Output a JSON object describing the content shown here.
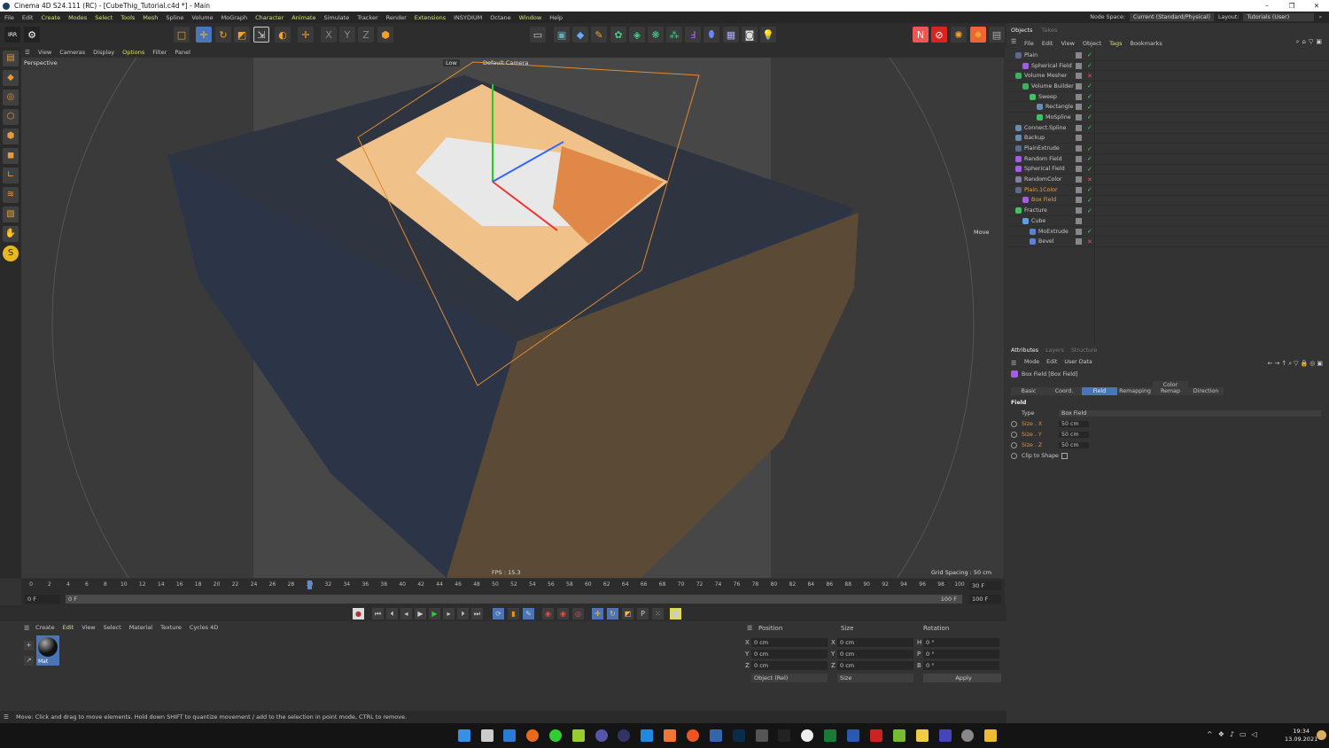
{
  "window": {
    "title": "Cinema 4D S24.111 (RC) - [CubeThig_Tutorial.c4d *] - Main",
    "controls": [
      "–",
      "❐",
      "✕"
    ]
  },
  "menu": [
    {
      "label": "File"
    },
    {
      "label": "Edit"
    },
    {
      "label": "Create",
      "hl": true
    },
    {
      "label": "Modes",
      "hl": true
    },
    {
      "label": "Select",
      "hl": true
    },
    {
      "label": "Tools",
      "hl": true
    },
    {
      "label": "Mesh",
      "hl": true
    },
    {
      "label": "Spline"
    },
    {
      "label": "Volume"
    },
    {
      "label": "MoGraph"
    },
    {
      "label": "Character",
      "hl": true
    },
    {
      "label": "Animate",
      "hl": true
    },
    {
      "label": "Simulate"
    },
    {
      "label": "Tracker"
    },
    {
      "label": "Render"
    },
    {
      "label": "Extensions",
      "hl": true
    },
    {
      "label": "INSYDIUM"
    },
    {
      "label": "Octane"
    },
    {
      "label": "Window",
      "hl": true
    },
    {
      "label": "Help"
    }
  ],
  "node_space": {
    "label": "Node Space:",
    "value": "Current (Standard/Physical)",
    "layout_label": "Layout:",
    "layout_value": "Tutorials (User)"
  },
  "toolbar": {
    "irr": "IRR"
  },
  "viewport": {
    "menu": [
      {
        "label": "View"
      },
      {
        "label": "Cameras"
      },
      {
        "label": "Display"
      },
      {
        "label": "Options",
        "hl": true
      },
      {
        "label": "Filter"
      },
      {
        "label": "Panel"
      }
    ],
    "name": "Perspective",
    "quality": "Low",
    "camera": "Default Camera",
    "tool": "Move",
    "fps": "FPS : 15.3",
    "grid": "Grid Spacing : 50 cm"
  },
  "timeline": {
    "start": 0,
    "end": 100,
    "step": 2,
    "current": 30,
    "fps_field": "30 F",
    "start_field": "0 F",
    "range_start": "0 F",
    "range_end": "100 F",
    "end_field": "100 F"
  },
  "materials": {
    "menu": [
      {
        "label": "Create"
      },
      {
        "label": "Edit",
        "hl": true
      },
      {
        "label": "View"
      },
      {
        "label": "Select"
      },
      {
        "label": "Material"
      },
      {
        "label": "Texture"
      },
      {
        "label": "Cycles 4D"
      }
    ],
    "items": [
      {
        "name": "Mat"
      }
    ]
  },
  "coords": {
    "headers": [
      "Position",
      "Size",
      "Rotation"
    ],
    "rows": [
      [
        "X",
        "0 cm",
        "X",
        "0 cm",
        "H",
        "0 °"
      ],
      [
        "Y",
        "0 cm",
        "Y",
        "0 cm",
        "P",
        "0 °"
      ],
      [
        "Z",
        "0 cm",
        "Z",
        "0 cm",
        "B",
        "0 °"
      ]
    ],
    "mode": "Object (Rel)",
    "size_mode": "Size",
    "apply": "Apply"
  },
  "status": "Move: Click and drag to move elements. Hold down SHIFT to quantize movement / add to the selection in point mode, CTRL to remove.",
  "objects": {
    "tabs": [
      "Objects",
      "Takes"
    ],
    "menu": [
      {
        "label": "File"
      },
      {
        "label": "Edit"
      },
      {
        "label": "View"
      },
      {
        "label": "Object"
      },
      {
        "label": "Tags",
        "hl": true
      },
      {
        "label": "Bookmarks"
      }
    ],
    "rows": [
      {
        "name": "Plain",
        "depth": 0,
        "icon": "#5a6a8a",
        "state": "✓"
      },
      {
        "name": "Spherical Field",
        "depth": 1,
        "icon": "#a060e0",
        "state": "✓"
      },
      {
        "name": "Volume Mesher",
        "depth": 0,
        "icon": "#40b060",
        "state": "✕"
      },
      {
        "name": "Volume Builder",
        "depth": 1,
        "icon": "#40b060",
        "state": "✓"
      },
      {
        "name": "Sweep",
        "depth": 2,
        "icon": "#40c060",
        "state": "✓"
      },
      {
        "name": "Rectangle",
        "depth": 3,
        "icon": "#6a8ab0",
        "state": "✓"
      },
      {
        "name": "MoSpline",
        "depth": 3,
        "icon": "#40c060",
        "state": "✓"
      },
      {
        "name": "Connect.Spline",
        "depth": 0,
        "icon": "#6a8ab0",
        "state": "✓"
      },
      {
        "name": "Backup",
        "depth": 0,
        "icon": "#6a8ab0",
        "state": ""
      },
      {
        "name": "PlainExtrude",
        "depth": 0,
        "icon": "#5a6a8a",
        "state": "✓"
      },
      {
        "name": "Random Field",
        "depth": 0,
        "icon": "#a060e0",
        "state": "✓"
      },
      {
        "name": "Spherical Field",
        "depth": 0,
        "icon": "#a060e0",
        "state": "✓"
      },
      {
        "name": "RandomColor",
        "depth": 0,
        "icon": "#8080a0",
        "state": "✕"
      },
      {
        "name": "Plain.1Color",
        "depth": 0,
        "icon": "#5a6a8a",
        "state": "✓",
        "active": true
      },
      {
        "name": "Box Field",
        "depth": 1,
        "icon": "#a060e0",
        "state": "✓",
        "active": true
      },
      {
        "name": "Fracture",
        "depth": 0,
        "icon": "#40c060",
        "state": "✓"
      },
      {
        "name": "Cube",
        "depth": 1,
        "icon": "#60a0e0",
        "state": ""
      },
      {
        "name": "MoExtrude",
        "depth": 2,
        "icon": "#6080d0",
        "state": "✓"
      },
      {
        "name": "Bevel",
        "depth": 2,
        "icon": "#6080d0",
        "state": "✕"
      }
    ]
  },
  "attributes": {
    "tabs": [
      "Attributes",
      "Layers",
      "Structure"
    ],
    "menu": [
      {
        "label": "Mode"
      },
      {
        "label": "Edit"
      },
      {
        "label": "User Data"
      }
    ],
    "object": "Box Field [Box Field]",
    "subtabs": [
      {
        "label": "Basic"
      },
      {
        "label": "Coord."
      },
      {
        "label": "Field",
        "on": true
      },
      {
        "label": "Remapping"
      },
      {
        "label": "Color Remap"
      },
      {
        "label": "Direction"
      }
    ],
    "section": "Field",
    "type_label": "Type",
    "type_value": "Box Field",
    "fields": [
      {
        "label": "Size . X",
        "value": "50 cm"
      },
      {
        "label": "Size . Y",
        "value": "50 cm"
      },
      {
        "label": "Size . Z",
        "value": "50 cm"
      }
    ],
    "clip_label": "Clip to Shape",
    "clip_checked": false
  },
  "clock": {
    "time": "19:34",
    "date": "13.09.2021"
  }
}
